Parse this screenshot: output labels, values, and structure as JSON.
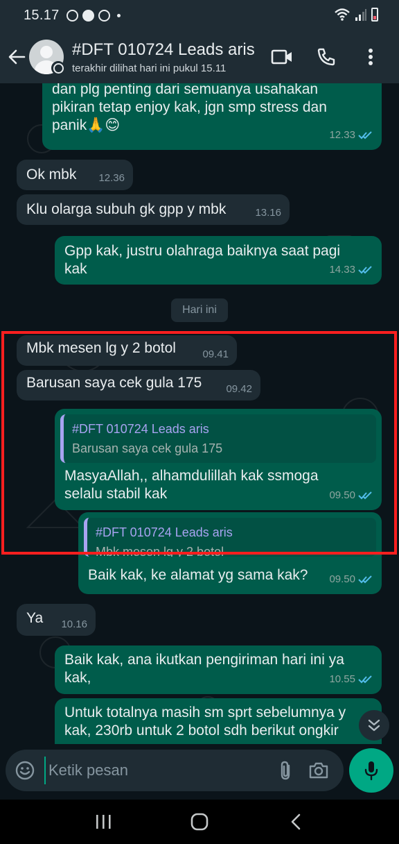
{
  "status_bar": {
    "time": "15.17"
  },
  "header": {
    "contact_name": "#DFT 010724 Leads aris",
    "last_seen": "terakhir dilihat hari ini pukul 15.11"
  },
  "date_divider": "Hari ini",
  "messages": [
    {
      "dir": "out",
      "lines": [
        "dan plg penting dari semuanya usahakan",
        "pikiran tetap enjoy kak, jgn smp stress dan",
        "panik🙏😊"
      ],
      "time": "12.33",
      "read": true
    },
    {
      "dir": "in",
      "lines": [
        "Ok mbk"
      ],
      "time": "12.36"
    },
    {
      "dir": "in",
      "lines": [
        "Klu olarga subuh gk gpp y mbk"
      ],
      "time": "13.16"
    },
    {
      "dir": "out",
      "lines": [
        "Gpp kak, justru olahraga baiknya saat pagi",
        "kak"
      ],
      "time": "14.33",
      "read": true
    },
    {
      "dir": "in",
      "lines": [
        "Mbk mesen lg y 2 botol"
      ],
      "time": "09.41"
    },
    {
      "dir": "in",
      "lines": [
        "Barusan saya cek gula 175"
      ],
      "time": "09.42"
    },
    {
      "dir": "out",
      "quote": {
        "author": "#DFT 010724 Leads aris",
        "text": "Barusan saya cek gula 175"
      },
      "lines": [
        "MasyaAllah,, alhamdulillah kak  ssmoga",
        "selalu stabil kak"
      ],
      "time": "09.50",
      "read": true
    },
    {
      "dir": "out",
      "quote": {
        "author": "#DFT 010724 Leads aris",
        "text": "Mbk mesen lg y 2 botol"
      },
      "lines": [
        "Baik kak, ke alamat yg sama kak?"
      ],
      "time": "09.50",
      "read": true
    },
    {
      "dir": "in",
      "lines": [
        "Ya"
      ],
      "time": "10.16"
    },
    {
      "dir": "out",
      "lines": [
        "Baik kak, ana ikutkan pengiriman hari ini ya",
        "kak,"
      ],
      "time": "10.55",
      "read": true
    },
    {
      "dir": "out",
      "lines": [
        "Untuk totalnya masih sm sprt sebelumnya y",
        "kak, 230rb untuk 2 botol sdh berikut ongkir"
      ]
    }
  ],
  "composer": {
    "placeholder": "Ketik pesan"
  },
  "colors": {
    "accent": "#00a884",
    "outgoing": "#005c4b",
    "incoming": "#1f2c34",
    "highlight": "#ff1f1f",
    "read_ticks": "#53bdeb"
  },
  "icons": [
    "back-arrow-icon",
    "video-call-icon",
    "voice-call-icon",
    "more-options-icon",
    "emoji-icon",
    "attach-icon",
    "camera-icon",
    "mic-icon",
    "double-chevron-down-icon",
    "read-receipt-icon"
  ]
}
